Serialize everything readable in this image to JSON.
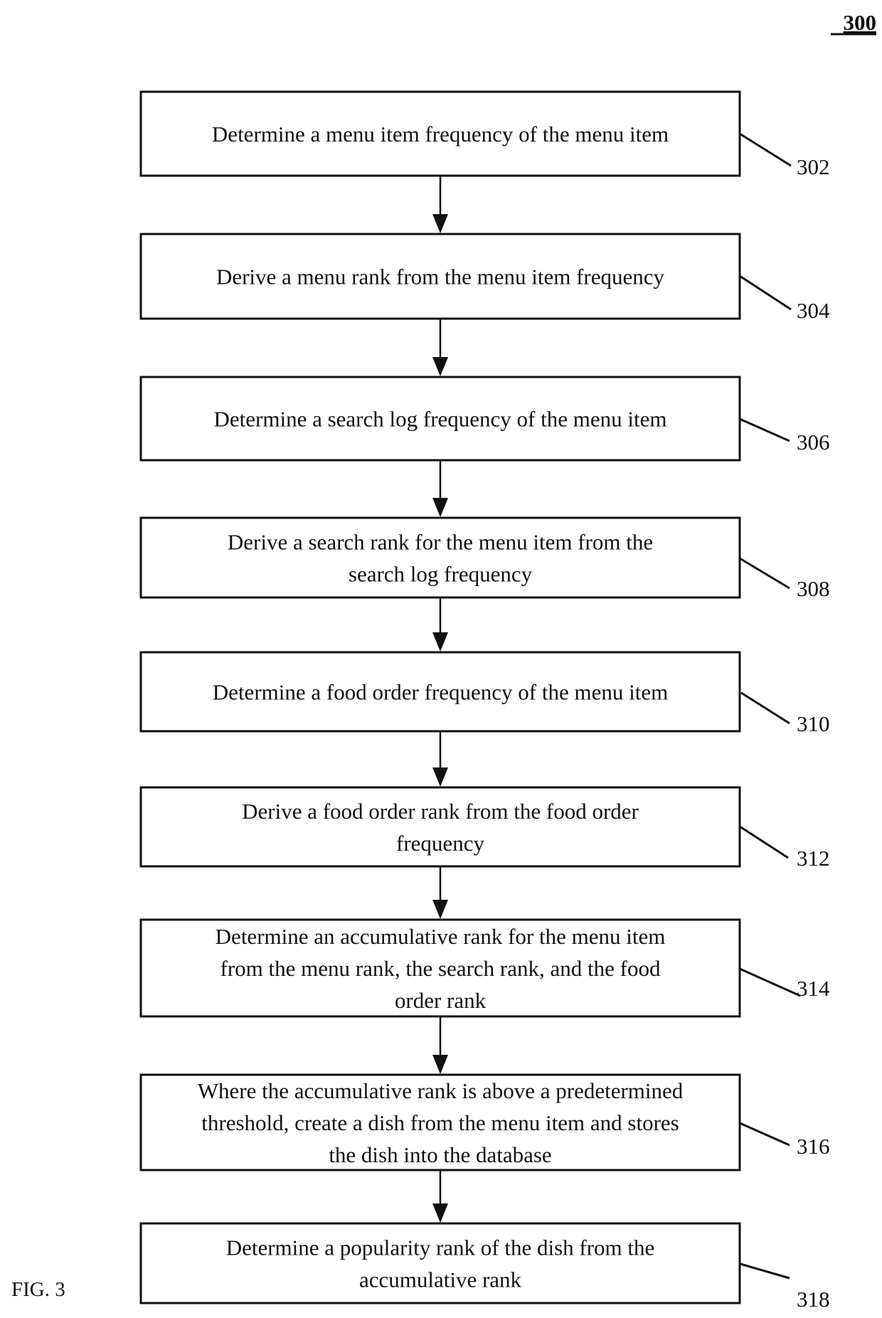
{
  "figure": {
    "number": "300",
    "caption": "FIG. 3"
  },
  "steps": [
    {
      "ref": "302",
      "lines": [
        "Determine a menu item frequency of the menu item"
      ]
    },
    {
      "ref": "304",
      "lines": [
        "Derive a menu rank from the menu item frequency"
      ]
    },
    {
      "ref": "306",
      "lines": [
        "Determine a search log frequency of the menu item"
      ]
    },
    {
      "ref": "308",
      "lines": [
        "Derive a search rank for the menu item from the",
        "search log frequency"
      ]
    },
    {
      "ref": "310",
      "lines": [
        "Determine a food order frequency of the menu item"
      ]
    },
    {
      "ref": "312",
      "lines": [
        "Derive a food order rank from the food order",
        "frequency"
      ]
    },
    {
      "ref": "314",
      "lines": [
        "Determine an accumulative rank for the menu item",
        "from the menu rank, the search rank, and the food",
        "order rank"
      ]
    },
    {
      "ref": "316",
      "lines": [
        "Where the accumulative rank is above a predetermined",
        "threshold, create a dish from the menu item and stores",
        "the dish into the database"
      ]
    },
    {
      "ref": "318",
      "lines": [
        "Determine a popularity rank of the dish from the",
        "accumulative rank"
      ]
    }
  ],
  "colors": {
    "ink": "#111111",
    "background": "#ffffff"
  }
}
